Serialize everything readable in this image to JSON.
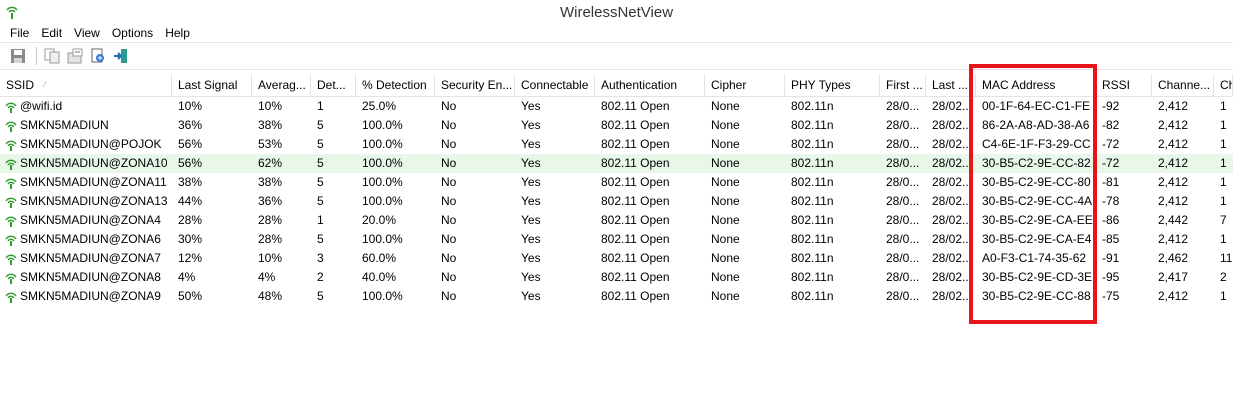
{
  "window": {
    "title": "WirelessNetView"
  },
  "menu": [
    "File",
    "Edit",
    "View",
    "Options",
    "Help"
  ],
  "toolbar": {
    "buttons": [
      {
        "name": "save-icon"
      },
      {
        "name": "copy-icon"
      },
      {
        "name": "properties-icon"
      },
      {
        "name": "html-report-icon"
      },
      {
        "name": "exit-icon"
      }
    ]
  },
  "columns": [
    {
      "label": "SSID",
      "width": 172
    },
    {
      "label": "Last Signal",
      "width": 80
    },
    {
      "label": "Averag...",
      "width": 59
    },
    {
      "label": "Det...",
      "width": 45
    },
    {
      "label": "% Detection",
      "width": 79
    },
    {
      "label": "Security En...",
      "width": 80
    },
    {
      "label": "Connectable",
      "width": 80
    },
    {
      "label": "Authentication",
      "width": 110
    },
    {
      "label": "Cipher",
      "width": 80
    },
    {
      "label": "PHY Types",
      "width": 95
    },
    {
      "label": "First ...",
      "width": 46
    },
    {
      "label": "Last ...",
      "width": 50
    },
    {
      "label": "MAC Address",
      "width": 120
    },
    {
      "label": "RSSI",
      "width": 56
    },
    {
      "label": "Channe...",
      "width": 62
    },
    {
      "label": "Ch",
      "width": 19
    }
  ],
  "rows": [
    [
      "@wifi.id",
      "10%",
      "10%",
      "1",
      "25.0%",
      "No",
      "Yes",
      "802.11 Open",
      "None",
      "802.11n",
      "28/0...",
      "28/02...",
      "00-1F-64-EC-C1-FE",
      "-92",
      "2,412",
      "1"
    ],
    [
      "SMKN5MADIUN",
      "36%",
      "38%",
      "5",
      "100.0%",
      "No",
      "Yes",
      "802.11 Open",
      "None",
      "802.11n",
      "28/0...",
      "28/02...",
      "86-2A-A8-AD-38-A6",
      "-82",
      "2,412",
      "1"
    ],
    [
      "SMKN5MADIUN@POJOK",
      "56%",
      "53%",
      "5",
      "100.0%",
      "No",
      "Yes",
      "802.11 Open",
      "None",
      "802.11n",
      "28/0...",
      "28/02...",
      "C4-6E-1F-F3-29-CC",
      "-72",
      "2,412",
      "1"
    ],
    [
      "SMKN5MADIUN@ZONA10",
      "56%",
      "62%",
      "5",
      "100.0%",
      "No",
      "Yes",
      "802.11 Open",
      "None",
      "802.11n",
      "28/0...",
      "28/02...",
      "30-B5-C2-9E-CC-82",
      "-72",
      "2,412",
      "1"
    ],
    [
      "SMKN5MADIUN@ZONA11",
      "38%",
      "38%",
      "5",
      "100.0%",
      "No",
      "Yes",
      "802.11 Open",
      "None",
      "802.11n",
      "28/0...",
      "28/02...",
      "30-B5-C2-9E-CC-80",
      "-81",
      "2,412",
      "1"
    ],
    [
      "SMKN5MADIUN@ZONA13",
      "44%",
      "36%",
      "5",
      "100.0%",
      "No",
      "Yes",
      "802.11 Open",
      "None",
      "802.11n",
      "28/0...",
      "28/02...",
      "30-B5-C2-9E-CC-4A",
      "-78",
      "2,412",
      "1"
    ],
    [
      "SMKN5MADIUN@ZONA4",
      "28%",
      "28%",
      "1",
      "20.0%",
      "No",
      "Yes",
      "802.11 Open",
      "None",
      "802.11n",
      "28/0...",
      "28/02...",
      "30-B5-C2-9E-CA-EE",
      "-86",
      "2,442",
      "7"
    ],
    [
      "SMKN5MADIUN@ZONA6",
      "30%",
      "28%",
      "5",
      "100.0%",
      "No",
      "Yes",
      "802.11 Open",
      "None",
      "802.11n",
      "28/0...",
      "28/02...",
      "30-B5-C2-9E-CA-E4",
      "-85",
      "2,412",
      "1"
    ],
    [
      "SMKN5MADIUN@ZONA7",
      "12%",
      "10%",
      "3",
      "60.0%",
      "No",
      "Yes",
      "802.11 Open",
      "None",
      "802.11n",
      "28/0...",
      "28/02...",
      "A0-F3-C1-74-35-62",
      "-91",
      "2,462",
      "11"
    ],
    [
      "SMKN5MADIUN@ZONA8",
      "4%",
      "4%",
      "2",
      "40.0%",
      "No",
      "Yes",
      "802.11 Open",
      "None",
      "802.11n",
      "28/0...",
      "28/02...",
      "30-B5-C2-9E-CD-3E",
      "-95",
      "2,417",
      "2"
    ],
    [
      "SMKN5MADIUN@ZONA9",
      "50%",
      "48%",
      "5",
      "100.0%",
      "No",
      "Yes",
      "802.11 Open",
      "None",
      "802.11n",
      "28/0...",
      "28/02...",
      "30-B5-C2-9E-CC-88",
      "-75",
      "2,412",
      "1"
    ]
  ],
  "selected_row": 3,
  "colors": {
    "highlight": "#e8131b",
    "selected_row": "#e8f7e8",
    "wifi_icon": "#2a9d2a"
  }
}
